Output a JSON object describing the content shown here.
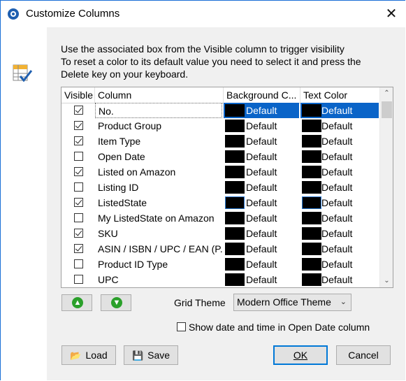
{
  "window": {
    "title": "Customize Columns",
    "close_glyph": "✕"
  },
  "info": {
    "line1": "Use the associated box from the Visible column to trigger visibility",
    "line2": "To reset a color to its default value you need to select it and press the",
    "line3": "Delete key on your keyboard."
  },
  "grid": {
    "headers": {
      "visible": "Visible",
      "column": "Column",
      "background": "Background C...",
      "text_color": "Text Color"
    },
    "rows": [
      {
        "name": "No.",
        "visible": true,
        "background": "Default",
        "text": "Default"
      },
      {
        "name": "Product Group",
        "visible": true,
        "background": "Default",
        "text": "Default"
      },
      {
        "name": "Item Type",
        "visible": true,
        "background": "Default",
        "text": "Default"
      },
      {
        "name": "Open Date",
        "visible": false,
        "background": "Default",
        "text": "Default"
      },
      {
        "name": "Listed on Amazon",
        "visible": true,
        "background": "Default",
        "text": "Default"
      },
      {
        "name": "Listing ID",
        "visible": false,
        "background": "Default",
        "text": "Default"
      },
      {
        "name": "ListedState",
        "visible": true,
        "background": "Default",
        "text": "Default"
      },
      {
        "name": "My ListedState on Amazon",
        "visible": false,
        "background": "Default",
        "text": "Default"
      },
      {
        "name": "SKU",
        "visible": true,
        "background": "Default",
        "text": "Default"
      },
      {
        "name": "ASIN / ISBN / UPC / EAN (P...",
        "visible": true,
        "background": "Default",
        "text": "Default"
      },
      {
        "name": "Product ID Type",
        "visible": false,
        "background": "Default",
        "text": "Default"
      },
      {
        "name": "UPC",
        "visible": false,
        "background": "Default",
        "text": "Default"
      }
    ]
  },
  "move_up_glyph": "▲",
  "move_down_glyph": "▼",
  "theme": {
    "label": "Grid Theme",
    "value": "Modern Office Theme"
  },
  "show_date": {
    "label": "Show date and time in Open Date column",
    "checked": false
  },
  "buttons": {
    "load": "Load",
    "save": "Save",
    "ok": "OK",
    "cancel": "Cancel"
  },
  "colors": {
    "accent": "#0078d7",
    "selection": "#0a64c8",
    "swatch": "#000000",
    "arrow_green": "#2aa02a"
  }
}
